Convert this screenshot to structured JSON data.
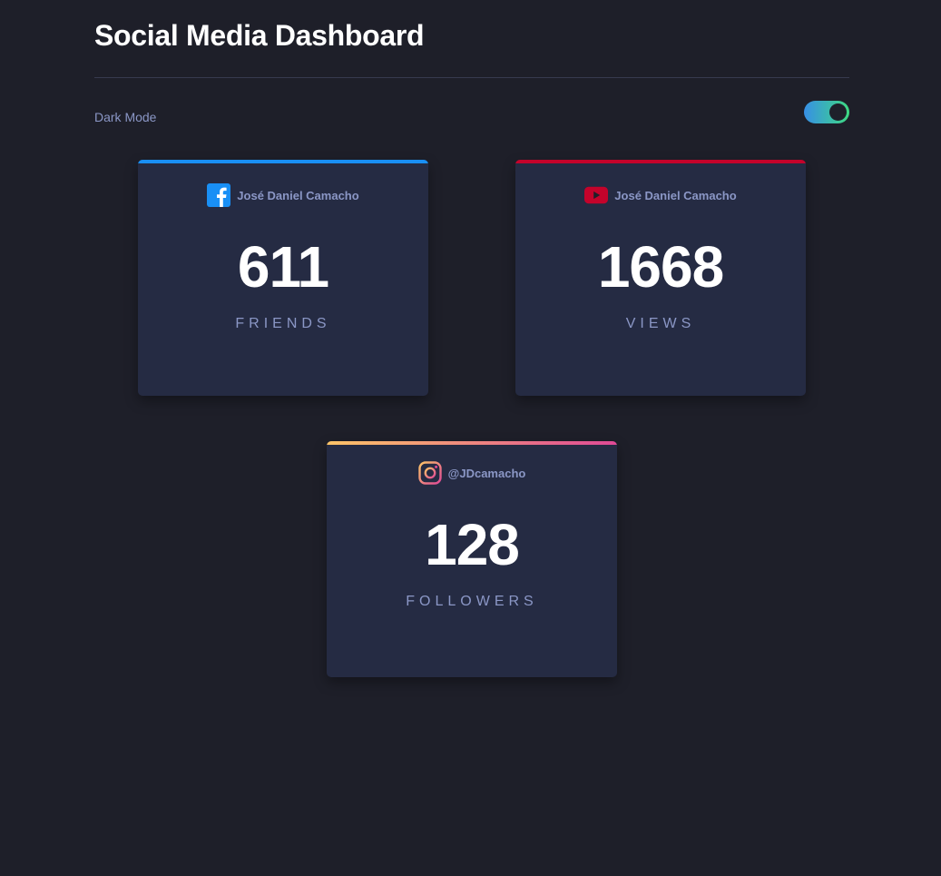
{
  "header": {
    "title": "Social Media Dashboard"
  },
  "toggle": {
    "label": "Dark Mode",
    "state": "on",
    "colors": [
      "#378fe6",
      "#3eda82"
    ]
  },
  "cards": [
    {
      "network": "facebook",
      "icon": "facebook-icon",
      "accent": "#198ff5",
      "handle": "José Daniel Camacho",
      "count": "611",
      "label": "FRIENDS"
    },
    {
      "network": "youtube",
      "icon": "youtube-icon",
      "accent": "#c4032b",
      "handle": "José Daniel Camacho",
      "count": "1668",
      "label": "VIEWS"
    },
    {
      "network": "instagram",
      "icon": "instagram-icon",
      "accent": [
        "#fdc468",
        "#df4996"
      ],
      "handle": "@JDcamacho",
      "count": "128",
      "label": "FOLLOWERS"
    }
  ]
}
